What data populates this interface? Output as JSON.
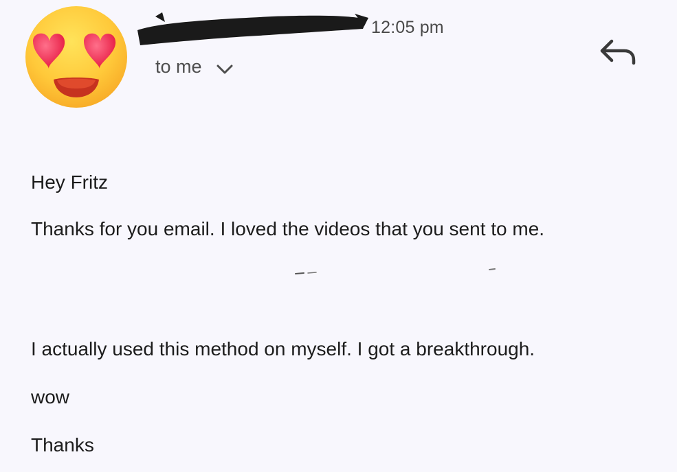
{
  "sender": {
    "avatar_icon": "heart-eyes-emoji-icon",
    "time": "12:05 pm",
    "recipient_label": "to me",
    "expand_icon": "chevron-down-icon"
  },
  "toolbar": {
    "reply_icon": "reply-arrow-icon"
  },
  "message": {
    "greeting": "Hey Fritz",
    "line1": "Thanks for you email. I loved the videos that you sent to me.",
    "line2": "I actually used this method on myself. I got a breakthrough.",
    "line3": "wow",
    "signoff": "Thanks"
  },
  "colors": {
    "background": "#f8f7fd",
    "text": "#1c1c1c",
    "meta_text": "#4e4e4e",
    "redaction": "#1a1a1a"
  }
}
